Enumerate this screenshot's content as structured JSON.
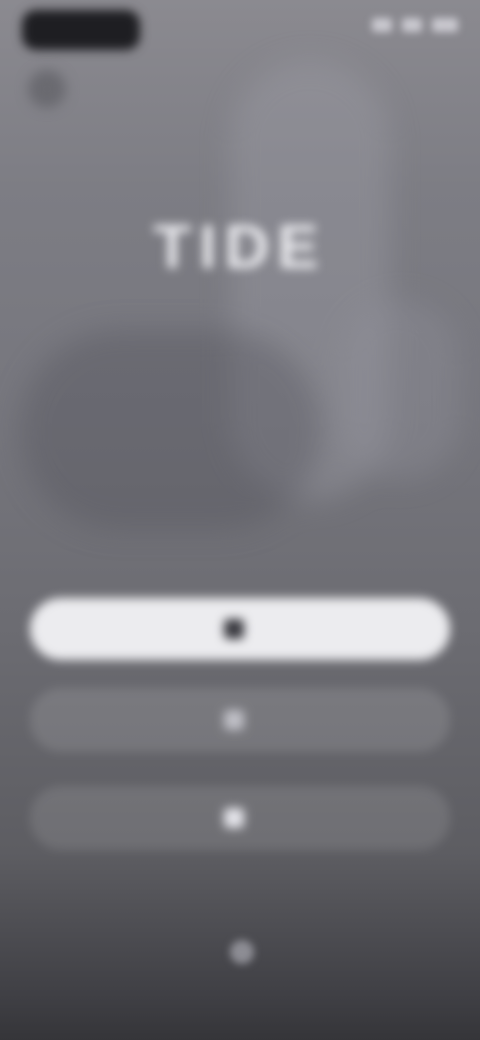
{
  "status_bar": {
    "time": "",
    "icons": [
      "signal-icon",
      "wifi-icon",
      "battery-icon"
    ]
  },
  "header": {
    "profile_icon": "profile-icon"
  },
  "brand": {
    "logo": "TIDE",
    "tagline": ""
  },
  "actions": {
    "primary_label": "",
    "primary_icon": "apple-icon",
    "secondary_label": "",
    "secondary_icon": "google-icon",
    "tertiary_label": "",
    "tertiary_icon": "mail-icon"
  },
  "legal": {
    "terms_text": ""
  },
  "footer": {
    "icon": "globe-icon",
    "text": ""
  },
  "colors": {
    "background": "#76767d",
    "primary_button": "#ececef",
    "secondary_button": "#8a8a90"
  }
}
